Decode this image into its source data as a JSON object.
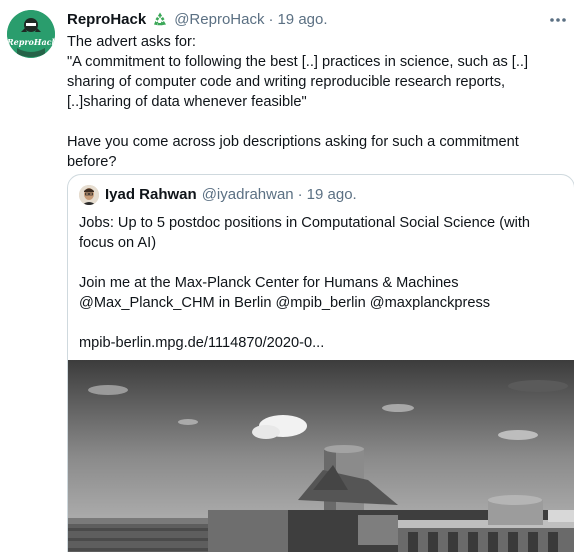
{
  "tweet": {
    "author_name": "ReproHack",
    "author_handle": "@ReproHack",
    "separator": "·",
    "date": "19 ago.",
    "avatar_label": "ReproHack",
    "text": "The advert asks for:\n\"A commitment to following the best [..] practices in science, such as [..] sharing of computer code and writing reproducible research reports, [..]sharing of data whenever feasible\"\n\nHave you come across job descriptions asking for such a commitment before?"
  },
  "quoted_tweet": {
    "author_name": "Iyad Rahwan",
    "author_handle": "@iyadrahwan",
    "separator": "·",
    "date": "19 ago.",
    "text": "Jobs: Up to 5 postdoc positions in Computational Social Science (with focus on AI)\n\nJoin me at the Max-Planck Center for Humans & Machines @Max_Planck_CHM in Berlin @mpib_berlin @maxplanckpress\n\nmpib-berlin.mpg.de/1114870/2020-0..."
  },
  "icons": {
    "author_badge": "recycle-icon",
    "menu": "more-icon"
  },
  "colors": {
    "text": "#0f1419",
    "secondary": "#5b7083",
    "avatar_green": "#2a9d6d",
    "border": "#cfd9de",
    "recycle_green": "#3aa757"
  }
}
